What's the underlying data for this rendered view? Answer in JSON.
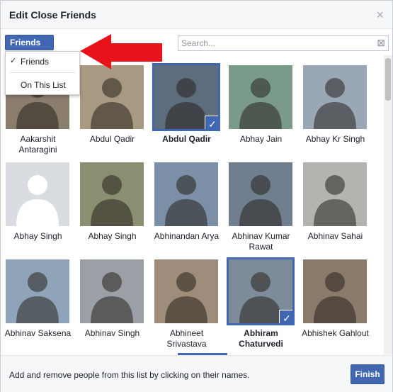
{
  "dialog": {
    "title": "Edit Close Friends",
    "close_glyph": "×"
  },
  "toolbar": {
    "filter_label": "Friends",
    "search_placeholder": "Search...",
    "search_clear_glyph": "⊠"
  },
  "dropdown": {
    "items": [
      {
        "label": "Friends",
        "checked": true,
        "check_glyph": "✓"
      },
      {
        "label": "On This List",
        "checked": false
      }
    ]
  },
  "people": [
    {
      "name": "Aakarshit Antaragini",
      "selected": false,
      "icon": "person-photo"
    },
    {
      "name": "Abdul Qadir",
      "selected": false,
      "icon": "person-photo"
    },
    {
      "name": "Abdul Qadir",
      "selected": true,
      "icon": "person-photo"
    },
    {
      "name": "Abhay Jain",
      "selected": false,
      "icon": "person-photo"
    },
    {
      "name": "Abhay Kr Singh",
      "selected": false,
      "icon": "person-photo"
    },
    {
      "name": "Abhay Singh",
      "selected": false,
      "icon": "default-avatar"
    },
    {
      "name": "Abhay Singh",
      "selected": false,
      "icon": "person-photo"
    },
    {
      "name": "Abhinandan Arya",
      "selected": false,
      "icon": "person-photo"
    },
    {
      "name": "Abhinav Kumar Rawat",
      "selected": false,
      "icon": "person-photo"
    },
    {
      "name": "Abhinav Sahai",
      "selected": false,
      "icon": "person-photo"
    },
    {
      "name": "Abhinav Saksena",
      "selected": false,
      "icon": "person-photo"
    },
    {
      "name": "Abhinav Singh",
      "selected": false,
      "icon": "person-photo"
    },
    {
      "name": "Abhineet Srivastava",
      "selected": false,
      "icon": "person-photo"
    },
    {
      "name": "Abhiram Chaturvedi",
      "selected": true,
      "icon": "person-photo"
    },
    {
      "name": "Abhishek Gahlout",
      "selected": false,
      "icon": "person-photo"
    }
  ],
  "selected_check_glyph": "✓",
  "footer": {
    "hint": "Add and remove people from this list by clicking on their names.",
    "finish_label": "Finish"
  },
  "colors": {
    "accent": "#4267b2",
    "annotation_arrow": "#e8131a"
  }
}
